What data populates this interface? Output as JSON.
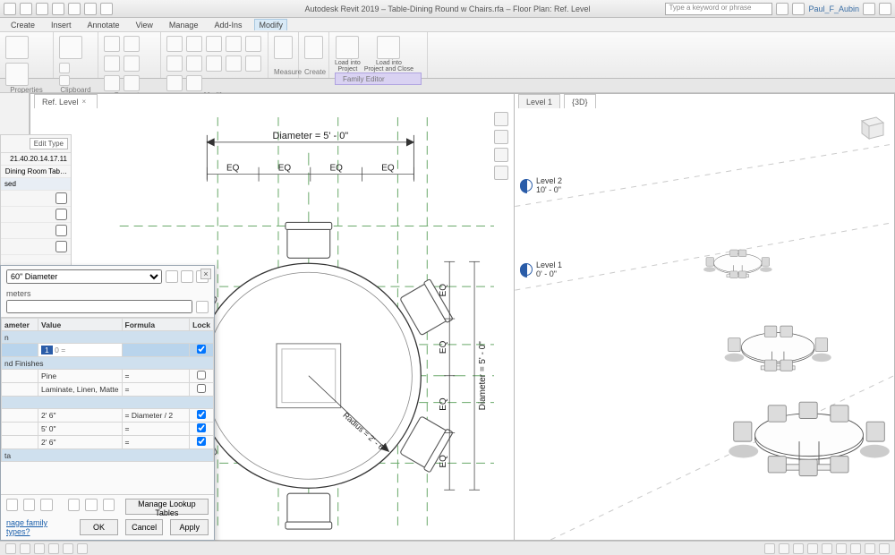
{
  "title": "Autodesk Revit 2019 – Table-Dining Round w Chairs.rfa – Floor Plan: Ref. Level",
  "search_placeholder": "Type a keyword or phrase",
  "user": "Paul_F_Aubin",
  "menus": {
    "items": [
      "Create",
      "Insert",
      "Annotate",
      "View",
      "Manage",
      "Add-Ins",
      "Modify"
    ],
    "active": "Modify"
  },
  "ribbon": {
    "panels": [
      {
        "label": "Properties"
      },
      {
        "label": "Clipboard"
      },
      {
        "label": "Geometry"
      },
      {
        "label": "Modify"
      },
      {
        "label": "Measure"
      },
      {
        "label": "Create"
      }
    ],
    "load_project": "Load into\nProject",
    "load_project_close": "Load into\nProject and Close",
    "family_editor": "Family Editor"
  },
  "views": {
    "plan_tab": "Ref. Level",
    "iso_tab1": "Level 1",
    "iso_tab2": "{3D}"
  },
  "plan": {
    "diameter_label": "Diameter = 5' - 0\"",
    "eq": "EQ",
    "radius_label": "Radius = 2' - 6\"",
    "side_dim": "Diameter = 5' - 0\""
  },
  "iso": {
    "level2": {
      "name": "Level 2",
      "elev": "10' - 0\""
    },
    "level1": {
      "name": "Level 1",
      "elev": "0' - 0\""
    }
  },
  "proppatch": {
    "edit_type": "Edit Type",
    "line1_val": "21.40.20.14.17.11",
    "line2_val": "Dining Room Tab…",
    "sed": "sed"
  },
  "dialog": {
    "type_name": "60\" Diameter",
    "parameters_title": "meters",
    "search_placeholder": "",
    "headers": {
      "parameter": "ameter",
      "value": "Value",
      "formula": "Formula",
      "lock": "Lock"
    },
    "rows": [
      {
        "section": true,
        "p": "n"
      },
      {
        "p": "",
        "v": "1",
        "vextra": "0 =",
        "f": "",
        "lock": true,
        "edit": true
      },
      {
        "section": true,
        "p": "nd Finishes"
      },
      {
        "p": "",
        "v": "Pine",
        "f": "=",
        "lock": false
      },
      {
        "p": "",
        "v": "Laminate, Linen, Matte",
        "f": "=",
        "lock": false
      },
      {
        "section": true,
        "p": ""
      },
      {
        "p": "",
        "v": "2'  6\"",
        "f": "= Diameter / 2",
        "lock": true
      },
      {
        "p": "",
        "v": "5'  0\"",
        "f": "=",
        "lock": true
      },
      {
        "p": "",
        "v": "2'  6\"",
        "f": "=",
        "lock": true
      },
      {
        "section": true,
        "p": "ta"
      }
    ],
    "lookup": "Manage Lookup Tables",
    "link": "nage family types?",
    "ok": "OK",
    "cancel": "Cancel",
    "apply": "Apply"
  }
}
